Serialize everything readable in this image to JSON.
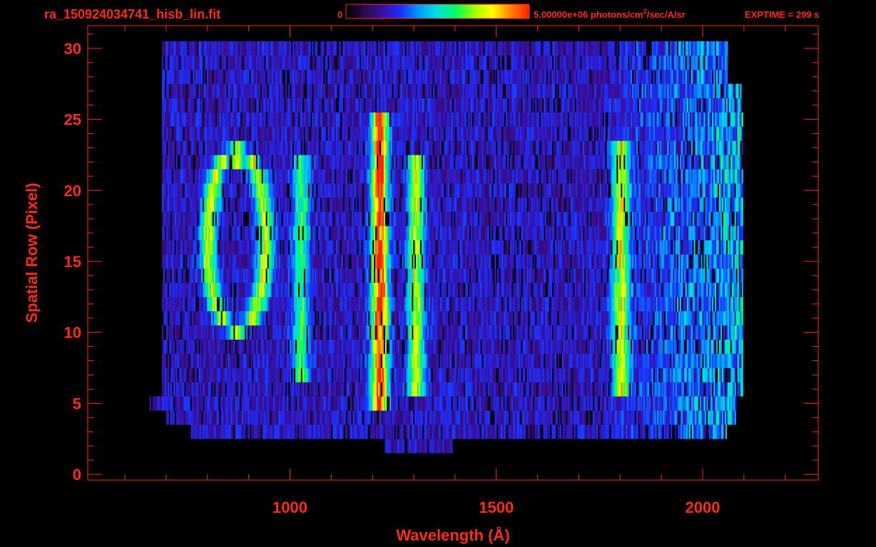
{
  "header": {
    "filename": "ra_150924034741_hisb_lin.fit",
    "colorbar_min_label": "0",
    "colorbar_max_label_prefix": "5.00000e+06 photons/cm",
    "colorbar_max_label_sup": "2",
    "colorbar_max_label_suffix": "/sec/A/sr",
    "exptime": "EXPTIME = 299 s"
  },
  "colors": {
    "axis": "#ff2a1a",
    "background": "#000000",
    "colormap": [
      "#000000",
      "#2a0a4a",
      "#3a10a0",
      "#1a30ff",
      "#00a0ff",
      "#00e0e0",
      "#00ff60",
      "#a0ff00",
      "#ffff00",
      "#ff8000",
      "#ff2000"
    ]
  },
  "chart_data": {
    "type": "heatmap",
    "title": "ra_150924034741_hisb_lin.fit",
    "xlabel": "Wavelength (Å)",
    "ylabel": "Spatial Row (Pixel)",
    "xlim": [
      510,
      2280
    ],
    "ylim": [
      -0.4,
      31.6
    ],
    "x_ticks": [
      1000,
      1500,
      2000
    ],
    "x_tick_labels": [
      "1000",
      "1500",
      "2000"
    ],
    "y_ticks": [
      0,
      5,
      10,
      15,
      20,
      25,
      30
    ],
    "y_tick_labels": [
      "0",
      "5",
      "10",
      "15",
      "20",
      "25",
      "30"
    ],
    "colorbar_range": [
      0,
      5000000
    ],
    "colorbar_units": "photons/cm^2/sec/A/sr",
    "features": [
      {
        "center_wavelength": 1216,
        "row_range": [
          5,
          25
        ],
        "intensity": 0.85
      },
      {
        "center_wavelength": 1304,
        "row_range": [
          6,
          22
        ],
        "intensity": 0.55
      },
      {
        "center_wavelength": 1025,
        "row_range": [
          7,
          22
        ],
        "intensity": 0.4
      },
      {
        "center_wavelength": 1800,
        "row_range": [
          6,
          23
        ],
        "intensity": 0.55
      },
      {
        "center_wavelength": 870,
        "row_range": [
          10,
          23
        ],
        "intensity": 0.55
      }
    ]
  }
}
